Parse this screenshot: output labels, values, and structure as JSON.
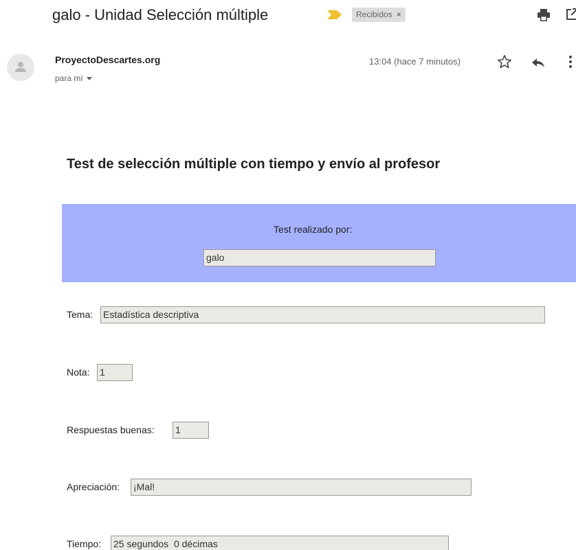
{
  "email": {
    "subject": "galo - Unidad Selección múltiple",
    "label_chip": "Recibidos",
    "label_chip_close": "×",
    "sender_name": "ProyectoDescartes.org",
    "recipient": "para mí",
    "timestamp": "13:04 (hace 7 minutos)"
  },
  "icons": {
    "label_marker": "important-marker-icon",
    "print": "print-icon",
    "popout": "open-in-new-window-icon",
    "avatar": "person-avatar-icon",
    "star": "star-icon",
    "reply": "reply-icon",
    "more": "more-vert-icon",
    "recipient_details": "caret-down-icon"
  },
  "colors": {
    "important_marker": "#f2c12e",
    "panel_background": "#a5b1ff",
    "field_background": "#ebe9e4"
  },
  "body": {
    "title": "Test de selección múltiple con tiempo y envío al profesor",
    "panel": {
      "label": "Test realizado por:",
      "name_value": "galo"
    },
    "rows": {
      "tema": {
        "label": "Tema:",
        "value": "Estadística descriptiva"
      },
      "nota": {
        "label": "Nota:",
        "value": "1"
      },
      "respuestas": {
        "label": "Respuestas buenas:",
        "value": "1"
      },
      "apreciacion": {
        "label": "Apreciación:",
        "value": "¡Mal!"
      },
      "tiempo": {
        "label": "Tiempo:",
        "value": "25 segundos  0 décimas"
      }
    }
  }
}
